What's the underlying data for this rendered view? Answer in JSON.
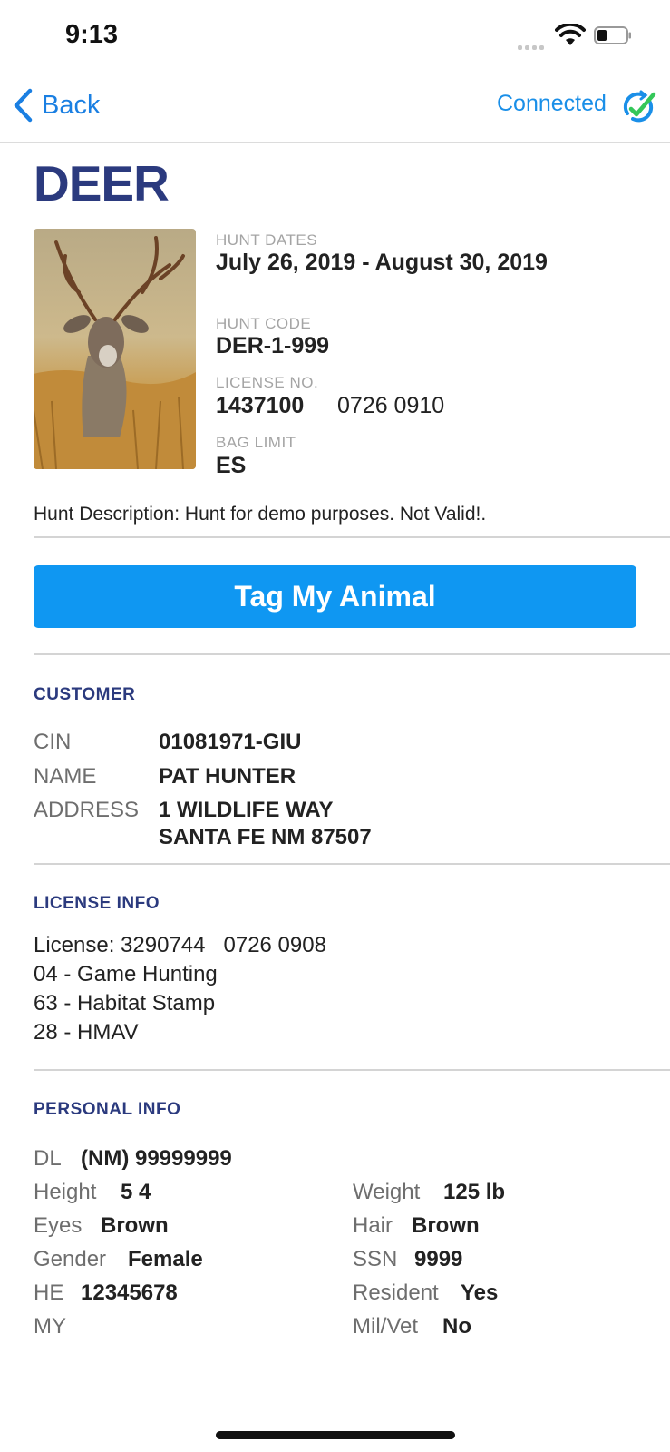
{
  "status_bar": {
    "time": "9:13"
  },
  "nav": {
    "back_label": "Back",
    "connection_status": "Connected"
  },
  "page_title": "DEER",
  "hunt": {
    "dates_label": "HUNT DATES",
    "dates_value": "July 26, 2019 - August 30, 2019",
    "code_label": "HUNT CODE",
    "code_value": "DER-1-999",
    "license_label": "LICENSE NO.",
    "license_number": "1437100",
    "license_date": "0726 0910",
    "bag_label": "BAG LIMIT",
    "bag_value": "ES",
    "description": "Hunt Description: Hunt for demo purposes. Not Valid!."
  },
  "tag_button_label": "Tag My Animal",
  "customer": {
    "heading": "CUSTOMER",
    "cin_label": "CIN",
    "cin_value": "01081971-GIU",
    "name_label": "NAME",
    "name_value": "PAT HUNTER",
    "address_label": "ADDRESS",
    "address_line1": "1 WILDLIFE WAY",
    "address_line2": "SANTA FE NM 87507"
  },
  "license_info": {
    "heading": "LICENSE INFO",
    "lines": [
      "License: 3290744   0726 0908",
      "04 - Game Hunting",
      "63 - Habitat Stamp",
      "28 - HMAV"
    ]
  },
  "personal_info": {
    "heading": "PERSONAL INFO",
    "dl_label": "DL",
    "dl_value": "(NM) 99999999",
    "height_label": "Height",
    "height_value": "5 4",
    "weight_label": "Weight",
    "weight_value": "125 lb",
    "eyes_label": "Eyes",
    "eyes_value": "Brown",
    "hair_label": "Hair",
    "hair_value": "Brown",
    "gender_label": "Gender",
    "gender_value": "Female",
    "ssn_label": "SSN",
    "ssn_value": "9999",
    "he_label": "HE",
    "he_value": "12345678",
    "resident_label": "Resident",
    "resident_value": "Yes",
    "my_label": "MY",
    "milvet_label": "Mil/Vet",
    "milvet_value": "No"
  },
  "colors": {
    "accent": "#0f97f2",
    "heading": "#2b3a7e",
    "link": "#1a7fe2",
    "check": "#34c759"
  },
  "icons": {
    "back": "chevron-left-icon",
    "sync": "sync-check-icon",
    "wifi": "wifi-icon",
    "battery": "battery-icon",
    "signal": "signal-icon"
  }
}
